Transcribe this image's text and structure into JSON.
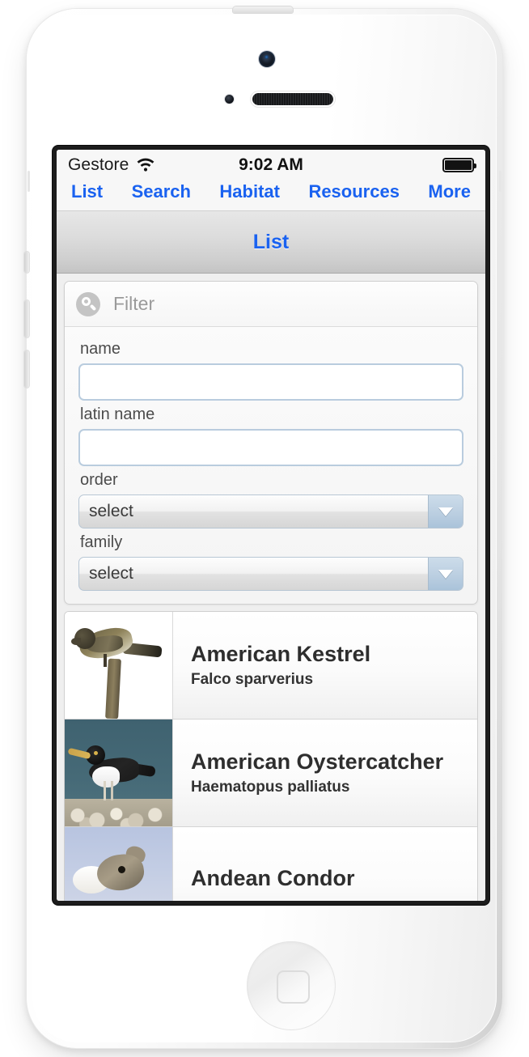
{
  "device": {
    "type": "white-smartphone",
    "camera": "front-camera",
    "speaker": "speaker-grille",
    "home_button": "home-button"
  },
  "status_bar": {
    "carrier": "Gestore",
    "wifi_icon": "wifi-icon",
    "time": "9:02 AM",
    "battery_icon": "battery-full-icon"
  },
  "nav": {
    "tabs": [
      {
        "label": "List"
      },
      {
        "label": "Search"
      },
      {
        "label": "Habitat"
      },
      {
        "label": "Resources"
      },
      {
        "label": "More"
      }
    ],
    "accent_color": "#1a62f0"
  },
  "title_bar": {
    "title": "List"
  },
  "filter": {
    "search": {
      "icon": "search-icon",
      "placeholder": "Filter",
      "value": ""
    },
    "fields": [
      {
        "label": "name",
        "type": "text",
        "value": "",
        "placeholder": ""
      },
      {
        "label": "latin name",
        "type": "text",
        "value": "",
        "placeholder": ""
      },
      {
        "label": "order",
        "type": "select",
        "value": "select"
      },
      {
        "label": "family",
        "type": "select",
        "value": "select"
      }
    ]
  },
  "list": {
    "items": [
      {
        "name": "American Kestrel",
        "latin": "Falco sparverius",
        "thumb": "kestrel-photo"
      },
      {
        "name": "American Oystercatcher",
        "latin": "Haematopus palliatus",
        "thumb": "oystercatcher-photo"
      },
      {
        "name": "Andean Condor",
        "latin": "",
        "thumb": "condor-photo"
      }
    ]
  }
}
